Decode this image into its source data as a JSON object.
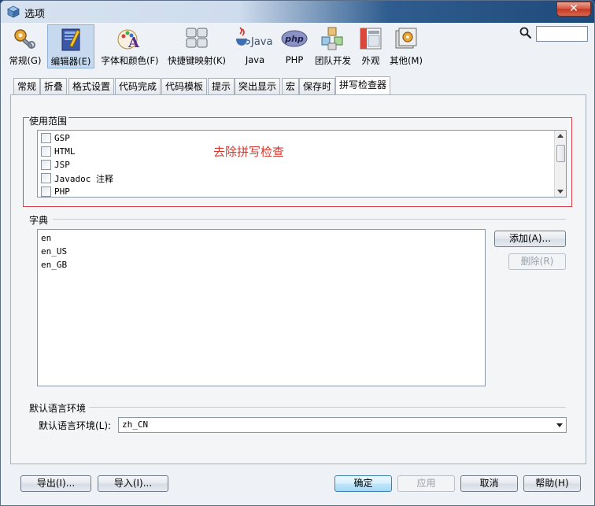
{
  "window": {
    "title": "选项",
    "close_label": "✕"
  },
  "toolbar": {
    "items": [
      {
        "label": "常规(G)",
        "icon": "general-settings-icon"
      },
      {
        "label": "编辑器(E)",
        "icon": "editor-icon"
      },
      {
        "label": "字体和颜色(F)",
        "icon": "fonts-colors-icon"
      },
      {
        "label": "快捷键映射(K)",
        "icon": "keymap-icon"
      },
      {
        "label": "Java",
        "icon": "java-icon"
      },
      {
        "label": "PHP",
        "icon": "php-icon"
      },
      {
        "label": "团队开发",
        "icon": "team-icon"
      },
      {
        "label": "外观",
        "icon": "appearance-icon"
      },
      {
        "label": "其他(M)",
        "icon": "misc-icon"
      }
    ],
    "selected_index": 1,
    "search_value": "",
    "java_logo_text": "Java",
    "php_logo_text": "php"
  },
  "tabs": [
    "常规",
    "折叠",
    "格式设置",
    "代码完成",
    "代码模板",
    "提示",
    "突出显示",
    "宏",
    "保存时",
    "拼写检查器"
  ],
  "active_tab": "拼写检查器",
  "scope": {
    "label": "使用范围",
    "items": [
      "GSP",
      "HTML",
      "JSP",
      "Javadoc 注释",
      "PHP"
    ],
    "annotation": "去除拼写检查"
  },
  "dictionary": {
    "label": "字典",
    "items": [
      "en",
      "en_US",
      "en_GB"
    ],
    "add_label": "添加(A)...",
    "remove_label": "删除(R)"
  },
  "locale": {
    "section_label": "默认语言环境",
    "field_label": "默认语言环境(L):",
    "value": "zh_CN"
  },
  "footer": {
    "export_label": "导出(I)...",
    "import_label": "导入(I)...",
    "ok_label": "确定",
    "apply_label": "应用",
    "cancel_label": "取消",
    "help_label": "帮助(H)"
  },
  "colors": {
    "annotation": "#d33a2f",
    "highlight_border": "#d9424a",
    "selected_tool": "#c7d9ef"
  }
}
